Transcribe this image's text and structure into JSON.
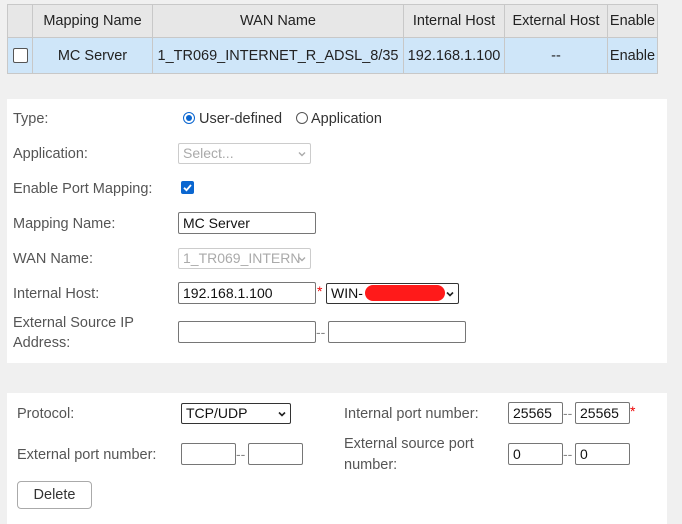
{
  "table": {
    "headers": [
      "Mapping Name",
      "WAN Name",
      "Internal Host",
      "External Host",
      "Enable"
    ],
    "rows": [
      {
        "mapping_name": "MC Server",
        "wan_name": "1_TR069_INTERNET_R_ADSL_8/35",
        "internal_host": "192.168.1.100",
        "external_host": "--",
        "enable": "Enable"
      }
    ]
  },
  "form": {
    "type_label": "Type:",
    "type_options": [
      "User-defined",
      "Application"
    ],
    "type_selected": "User-defined",
    "application_label": "Application:",
    "application_value": "Select...",
    "enable_port_mapping_label": "Enable Port Mapping:",
    "enable_port_mapping_checked": true,
    "mapping_name_label": "Mapping Name:",
    "mapping_name_value": "MC Server",
    "wan_name_label": "WAN Name:",
    "wan_name_value": "1_TR069_INTERN",
    "internal_host_label": "Internal Host:",
    "internal_host_value": "192.168.1.100",
    "internal_host_device": "WIN-",
    "external_source_ip_label_line1": "External Source IP",
    "external_source_ip_label_line2": "Address:",
    "external_source_ip_start": "",
    "external_source_ip_end": ""
  },
  "ports": {
    "protocol_label": "Protocol:",
    "protocol_value": "TCP/UDP",
    "internal_port_label": "Internal port number:",
    "internal_port_start": "25565",
    "internal_port_end": "25565",
    "external_port_label": "External port number:",
    "external_port_start": "",
    "external_port_end": "",
    "external_source_port_label_line1": "External source port",
    "external_source_port_label_line2": "number:",
    "external_source_port_start": "0",
    "external_source_port_end": "0",
    "delete_label": "Delete"
  },
  "symbols": {
    "dash": "--",
    "required": "*"
  },
  "colors": {
    "selected_row": "#cfe6f9",
    "accent": "#0a66d0",
    "redaction": "#ff1a1a"
  }
}
